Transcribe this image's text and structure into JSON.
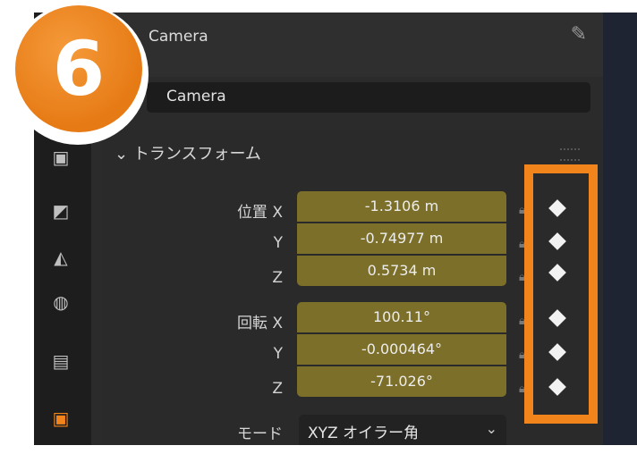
{
  "header": {
    "title": "Camera",
    "pin_icon": "pin-icon"
  },
  "object_name": {
    "value": "Camera"
  },
  "transform": {
    "title": "トランスフォーム",
    "location": {
      "labels": [
        "位置 X",
        "Y",
        "Z"
      ],
      "values": [
        "-1.3106 m",
        "-0.74977 m",
        "0.5734 m"
      ]
    },
    "rotation": {
      "labels": [
        "回転 X",
        "Y",
        "Z"
      ],
      "values": [
        "100.11°",
        "-0.000464°",
        "-71.026°"
      ]
    },
    "mode": {
      "label": "モード",
      "value": "XYZ オイラー角"
    }
  },
  "badge": {
    "number": "6"
  },
  "colors": {
    "field": "#7b6f2a",
    "highlight": "#f2841c",
    "badge": "#e67a14"
  }
}
